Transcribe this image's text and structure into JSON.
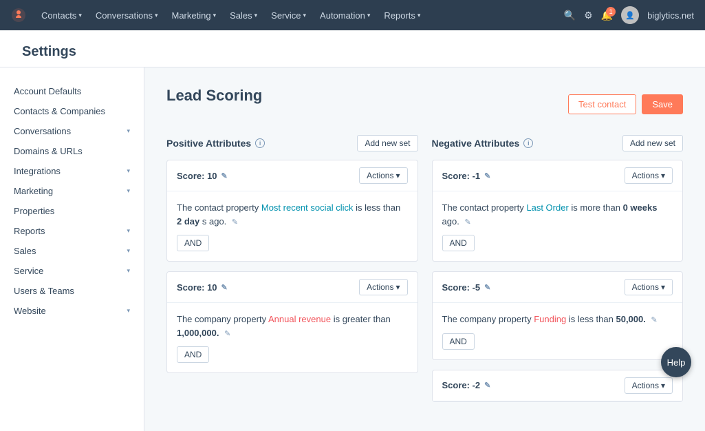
{
  "nav": {
    "logo": "🟠",
    "items": [
      {
        "label": "Contacts",
        "caret": "▾"
      },
      {
        "label": "Conversations",
        "caret": "▾"
      },
      {
        "label": "Marketing",
        "caret": "▾"
      },
      {
        "label": "Sales",
        "caret": "▾"
      },
      {
        "label": "Service",
        "caret": "▾"
      },
      {
        "label": "Automation",
        "caret": "▾"
      },
      {
        "label": "Reports",
        "caret": "▾"
      }
    ],
    "domain": "biglytics.net",
    "notif_count": "1"
  },
  "sidebar": {
    "items": [
      {
        "label": "Account Defaults",
        "has_caret": false
      },
      {
        "label": "Contacts & Companies",
        "has_caret": false
      },
      {
        "label": "Conversations",
        "has_caret": true
      },
      {
        "label": "Domains & URLs",
        "has_caret": false
      },
      {
        "label": "Integrations",
        "has_caret": true
      },
      {
        "label": "Marketing",
        "has_caret": true
      },
      {
        "label": "Properties",
        "has_caret": false
      },
      {
        "label": "Reports",
        "has_caret": true
      },
      {
        "label": "Sales",
        "has_caret": true
      },
      {
        "label": "Service",
        "has_caret": true
      },
      {
        "label": "Users & Teams",
        "has_caret": false
      },
      {
        "label": "Website",
        "has_caret": true
      }
    ]
  },
  "settings_title": "Settings",
  "page": {
    "title": "Lead Scoring",
    "test_contact_label": "Test contact",
    "save_label": "Save",
    "positive": {
      "title": "Positive Attributes",
      "info": "i",
      "add_btn": "Add new set",
      "scores": [
        {
          "score_label": "Score: 10",
          "actions_label": "Actions",
          "rule": "The contact property",
          "rule_link": "Most recent social click",
          "rule_mid": "is less than",
          "rule_bold": "2 day",
          "rule_suffix": "s ago.",
          "and_label": "AND"
        },
        {
          "score_label": "Score: 10",
          "actions_label": "Actions",
          "rule": "The company property",
          "rule_link": "Annual revenue",
          "rule_mid": "is greater than",
          "rule_bold": "1,000,000.",
          "rule_suffix": "",
          "and_label": "AND"
        }
      ]
    },
    "negative": {
      "title": "Negative Attributes",
      "info": "i",
      "add_btn": "Add new set",
      "scores": [
        {
          "score_label": "Score: -1",
          "actions_label": "Actions",
          "rule": "The contact property",
          "rule_link": "Last Order",
          "rule_mid": "is more than",
          "rule_bold": "0 weeks",
          "rule_suffix": "ago.",
          "and_label": "AND"
        },
        {
          "score_label": "Score: -5",
          "actions_label": "Actions",
          "rule": "The company property",
          "rule_link": "Funding",
          "rule_mid": "is less than",
          "rule_bold": "50,000.",
          "rule_suffix": "",
          "and_label": "AND"
        },
        {
          "score_label": "Score: -2",
          "actions_label": "Actions",
          "rule": "",
          "rule_link": "",
          "rule_mid": "",
          "rule_bold": "",
          "rule_suffix": "",
          "and_label": ""
        }
      ]
    }
  },
  "help": "Help"
}
